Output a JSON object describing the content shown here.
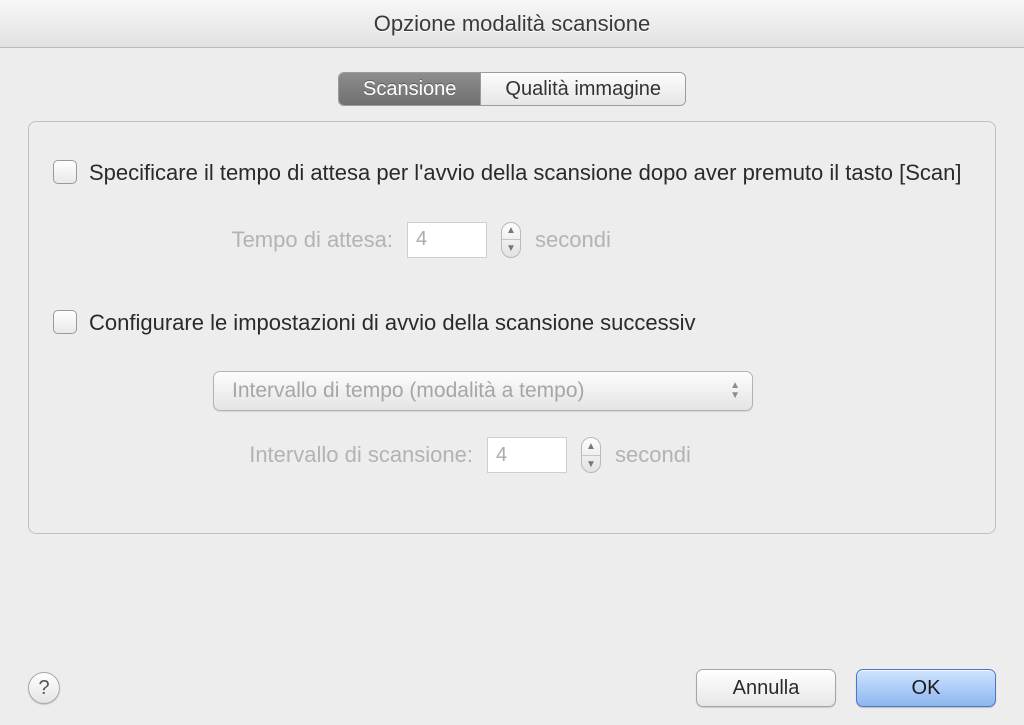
{
  "window": {
    "title": "Opzione modalità scansione"
  },
  "tabs": {
    "scan": "Scansione",
    "quality": "Qualità immagine"
  },
  "option1": {
    "label": "Specificare il tempo di attesa per l'avvio della scansione dopo aver premuto il tasto [Scan]",
    "wait_label": "Tempo di attesa:",
    "wait_value": "4",
    "wait_unit": "secondi"
  },
  "option2": {
    "label": "Configurare le impostazioni di avvio della scansione successiv",
    "mode_select": "Intervallo di tempo (modalità a tempo)",
    "interval_label": "Intervallo di scansione:",
    "interval_value": "4",
    "interval_unit": "secondi"
  },
  "footer": {
    "help": "?",
    "cancel": "Annulla",
    "ok": "OK"
  }
}
